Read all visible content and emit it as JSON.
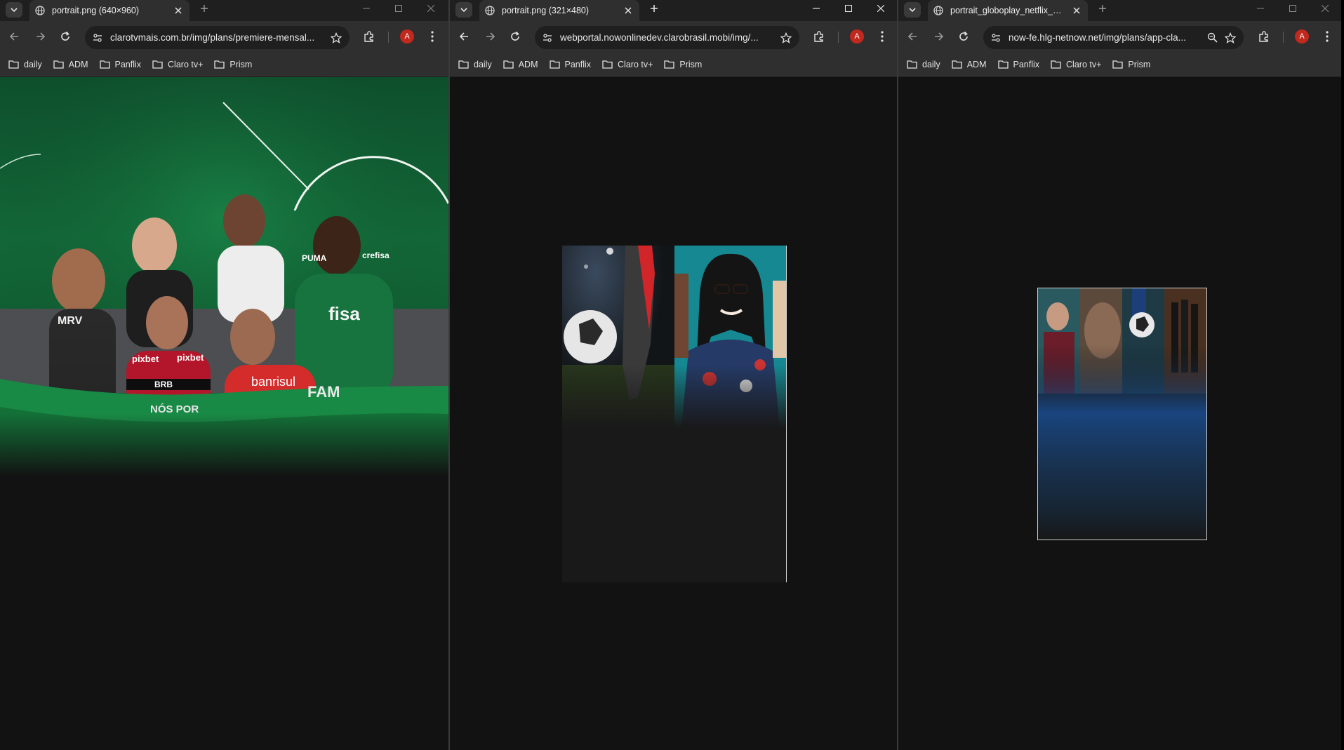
{
  "bookmarks": [
    "daily",
    "ADM",
    "Panflix",
    "Claro tv+",
    "Prism"
  ],
  "avatar_letter": "A",
  "windows": [
    {
      "tab_title": "portrait.png (640×960)",
      "url": "clarotvmais.com.br/img/plans/premiere-mensal...",
      "image": "premiere-soccer-players"
    },
    {
      "tab_title": "portrait.png (321×480)",
      "url": "webportal.nowonlinedev.clarobrasil.mobi/img/...",
      "image": "soccer-cleat-and-woman"
    },
    {
      "tab_title": "portrait_globoplay_netflix_prem",
      "url": "now-fe.hlg-netnow.net/img/plans/app-cla...",
      "image": "globoplay-netflix-collage"
    }
  ],
  "image1_text": {
    "jersey_left": "MRV",
    "pixbet_1": "pixbet",
    "pixbet_2": "pixbet",
    "brb": "BRB",
    "nos_por": "NÓS POR",
    "banrisul": "banrisul",
    "crefisa_1": "crefisa",
    "crefisa_2": "fisa",
    "puma": "PUMA",
    "fam": "FAM"
  },
  "colors": {
    "tab_bg": "#2f2f2f",
    "frame": "#1f1f1f",
    "page_bg": "#121212",
    "avatar": "#c1281e",
    "green": "#136a39"
  }
}
